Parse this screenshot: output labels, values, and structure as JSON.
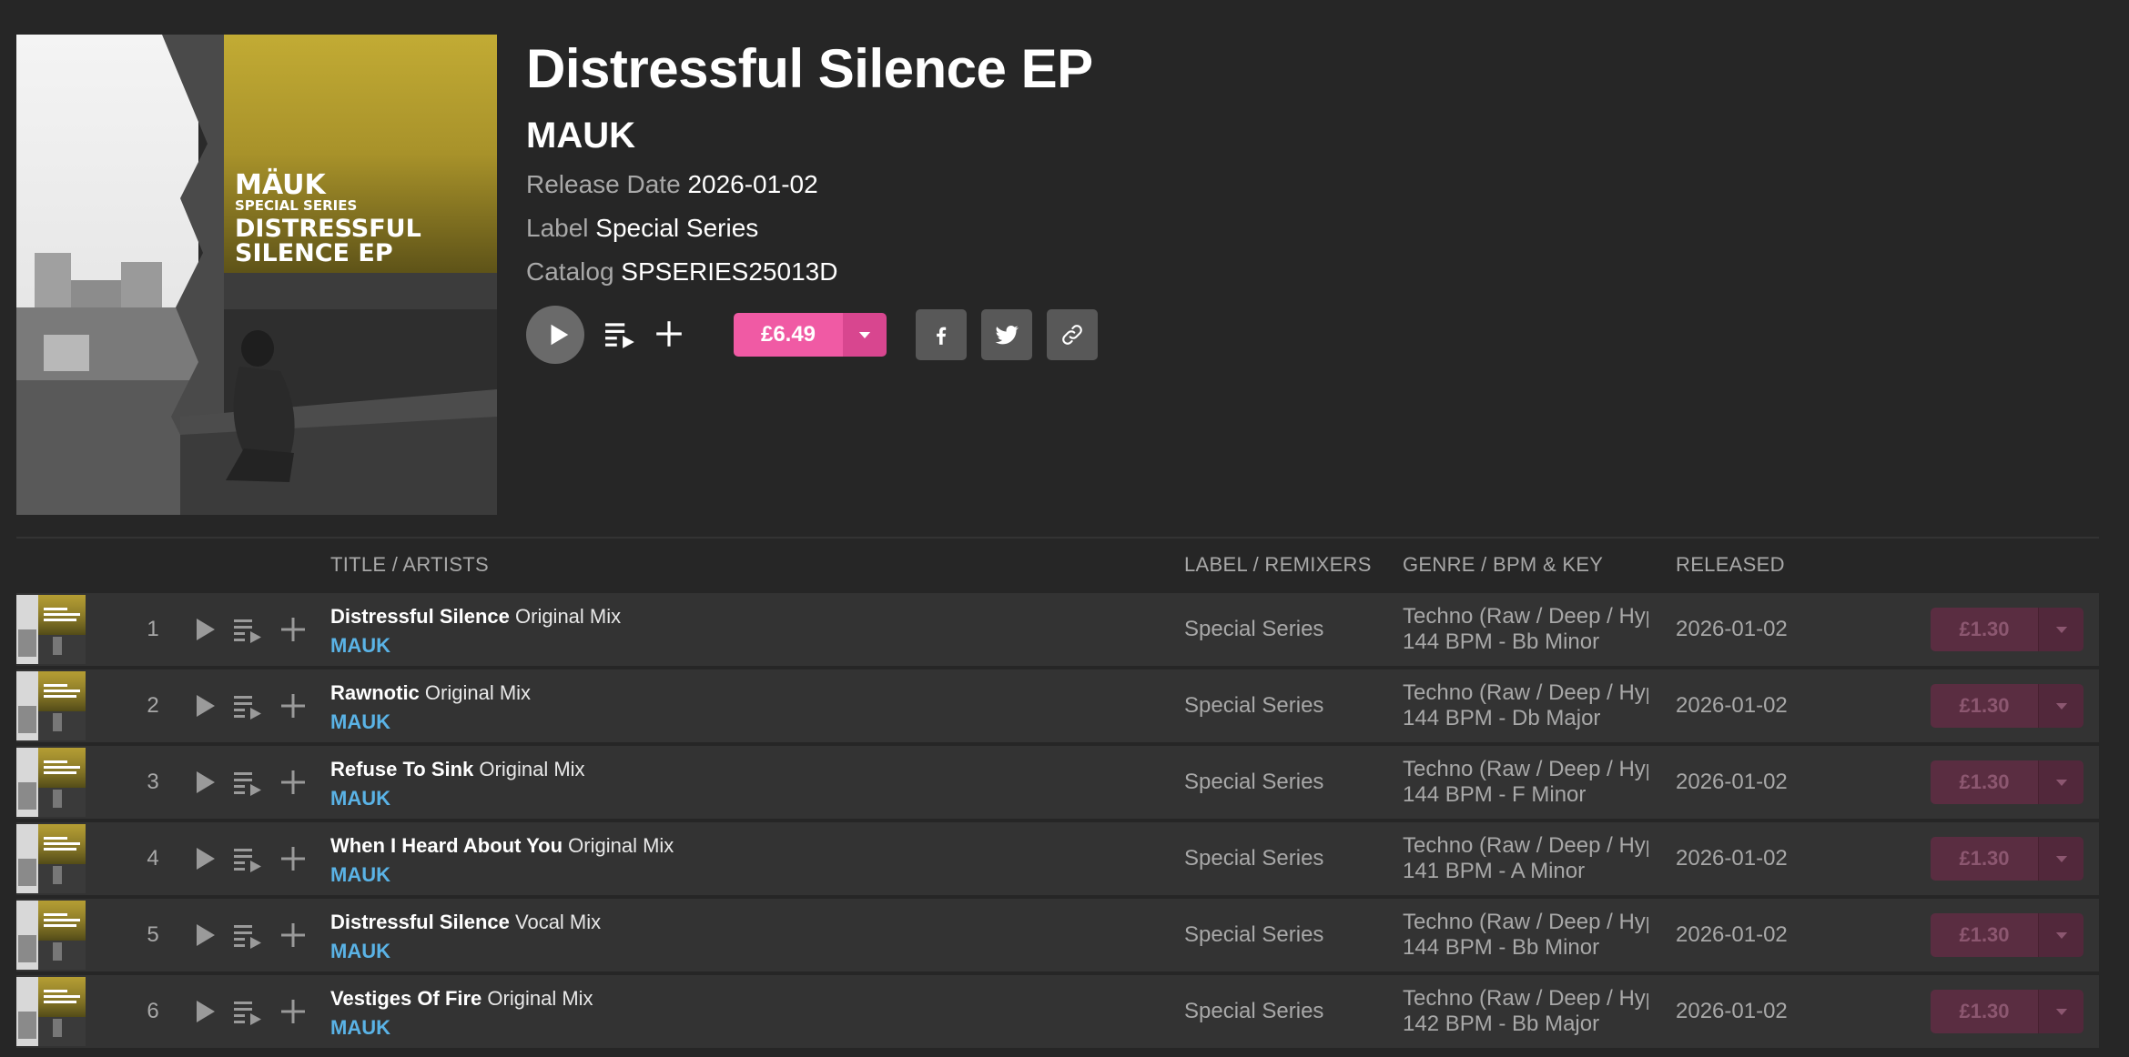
{
  "release": {
    "title": "Distressful Silence EP",
    "artist": "MAUK",
    "release_date_label": "Release Date",
    "release_date": "2026-01-02",
    "label_label": "Label",
    "label": "Special Series",
    "catalog_label": "Catalog",
    "catalog": "SPSERIES25013D",
    "price": "£6.49",
    "cover_text": {
      "artist": "MÄUK",
      "series": "SPECIAL SERIES",
      "title_line1": "DISTRESSFUL",
      "title_line2": "SILENCE EP"
    }
  },
  "columns": {
    "title": "TITLE / ARTISTS",
    "label": "LABEL / REMIXERS",
    "genre": "GENRE / BPM & KEY",
    "released": "RELEASED"
  },
  "tracks": [
    {
      "num": "1",
      "name": "Distressful Silence",
      "mix": "Original Mix",
      "artist": "MAUK",
      "label": "Special Series",
      "genre": "Techno (Raw / Deep / Hypnotic)",
      "bpm_key": "144 BPM - Bb Minor",
      "released": "2026-01-02",
      "price": "£1.30"
    },
    {
      "num": "2",
      "name": "Rawnotic",
      "mix": "Original Mix",
      "artist": "MAUK",
      "label": "Special Series",
      "genre": "Techno (Raw / Deep / Hypnotic)",
      "bpm_key": "144 BPM - Db Major",
      "released": "2026-01-02",
      "price": "£1.30"
    },
    {
      "num": "3",
      "name": "Refuse To Sink",
      "mix": "Original Mix",
      "artist": "MAUK",
      "label": "Special Series",
      "genre": "Techno (Raw / Deep / Hypnotic)",
      "bpm_key": "144 BPM - F Minor",
      "released": "2026-01-02",
      "price": "£1.30"
    },
    {
      "num": "4",
      "name": "When I Heard About You",
      "mix": "Original Mix",
      "artist": "MAUK",
      "label": "Special Series",
      "genre": "Techno (Raw / Deep / Hypnotic)",
      "bpm_key": "141 BPM - A Minor",
      "released": "2026-01-02",
      "price": "£1.30"
    },
    {
      "num": "5",
      "name": "Distressful Silence",
      "mix": "Vocal Mix",
      "artist": "MAUK",
      "label": "Special Series",
      "genre": "Techno (Raw / Deep / Hypnotic)",
      "bpm_key": "144 BPM - Bb Minor",
      "released": "2026-01-02",
      "price": "£1.30"
    },
    {
      "num": "6",
      "name": "Vestiges Of Fire",
      "mix": "Original Mix",
      "artist": "MAUK",
      "label": "Special Series",
      "genre": "Techno (Raw / Deep / Hypnotic)",
      "bpm_key": "142 BPM - Bb Major",
      "released": "2026-01-02",
      "price": "£1.30"
    }
  ],
  "icons": {
    "play": "play-icon",
    "queue": "add-to-queue-icon",
    "add": "plus-icon",
    "dropdown": "caret-down-icon",
    "facebook": "facebook-icon",
    "twitter": "twitter-icon",
    "link": "link-icon"
  },
  "colors": {
    "background": "#262626",
    "row_background": "#333333",
    "buy_accent": "#f05aa4",
    "artist_link": "#5ab3e6",
    "muted_text": "#a8a8a8"
  }
}
